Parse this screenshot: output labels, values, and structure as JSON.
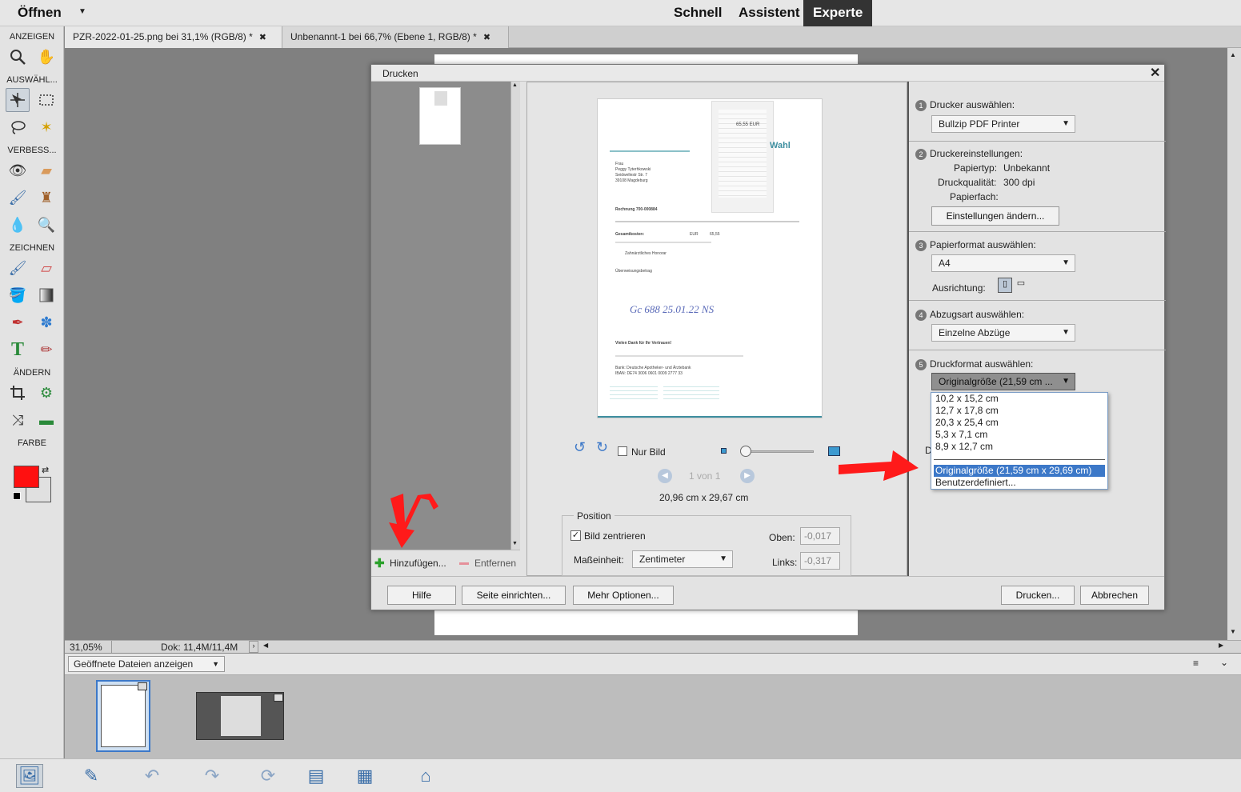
{
  "menubar": {
    "open": "Öffnen",
    "modes": [
      "Schnell",
      "Assistent",
      "Experte"
    ]
  },
  "toolbox": {
    "sections": [
      "ANZEIGEN",
      "AUSWÄHL...",
      "VERBESS...",
      "ZEICHNEN",
      "ÄNDERN",
      "FARBE"
    ],
    "foreground_color": "#ff1010",
    "background_color": "#e0e0e0"
  },
  "tabs": [
    {
      "label": "PZR-2022-01-25.png bei 31,1% (RGB/8) *"
    },
    {
      "label": "Unbenannt-1 bei 66,7% (Ebene 1, RGB/8) *"
    }
  ],
  "status": {
    "zoom": "31,05%",
    "doc": "Dok: 11,4M/11,4M"
  },
  "bin": {
    "select": "Geöffnete Dateien anzeigen"
  },
  "dialog": {
    "title": "Drucken",
    "add": "Hinzufügen...",
    "remove": "Entfernen",
    "only_image": "Nur Bild",
    "page_of": "1 von 1",
    "size": "20,96 cm x 29,67 cm",
    "position": {
      "legend": "Position",
      "center": "Bild zentrieren",
      "top_label": "Oben:",
      "top_value": "-0,017",
      "unit_label": "Maßeinheit:",
      "unit_value": "Zentimeter",
      "left_label": "Links:",
      "left_value": "-0,317"
    },
    "steps": {
      "s1": {
        "num": "1",
        "title": "Drucker auswählen:",
        "value": "Bullzip PDF Printer"
      },
      "s2": {
        "num": "2",
        "title": "Druckereinstellungen:",
        "paper_type_label": "Papiertyp:",
        "paper_type": "Unbekannt",
        "quality_label": "Druckqualität:",
        "quality": "300 dpi",
        "tray_label": "Papierfach:",
        "button": "Einstellungen ändern..."
      },
      "s3": {
        "num": "3",
        "title": "Papierformat auswählen:",
        "value": "A4",
        "orientation_label": "Ausrichtung:"
      },
      "s4": {
        "num": "4",
        "title": "Abzugsart auswählen:",
        "value": "Einzelne Abzüge"
      },
      "s5": {
        "num": "5",
        "title": "Druckformat auswählen:",
        "value": "Originalgröße (21,59 cm ...",
        "partial_letter": "D"
      }
    },
    "dropdown": [
      "10,2 x 15,2 cm",
      "12,7 x 17,8 cm",
      "20,3 x 25,4 cm",
      "5,3 x 7,1 cm",
      "8,9 x 12,7 cm",
      "Originalgröße (21,59 cm x 29,69 cm)",
      "Benutzerdefiniert..."
    ],
    "buttons": {
      "help": "Hilfe",
      "page_setup": "Seite einrichten...",
      "more": "Mehr Optionen...",
      "print": "Drucken...",
      "cancel": "Abbrechen"
    }
  },
  "preview": {
    "brand": "Wahl",
    "lines": [
      "Frau",
      "Peggy Tyterhkowski",
      "Seidwellestr Str. 7",
      "39108 Magdeburg",
      "Rechnung 700-000884",
      "Gesamtkosten:",
      "EUR",
      "65,55",
      "Zahnärztliches Honorar",
      "Überweisungsbetrag",
      "Vielen Dank für Ihr Vertrauen!",
      "Bank:  Deutsche Apotheker- und Ärztebank",
      "IBAN:  DE74 3006 0601 0009 2777 33"
    ],
    "receipt_total": "65,55 EUR",
    "handwriting": "Gc 688 25.01.22  NS"
  }
}
